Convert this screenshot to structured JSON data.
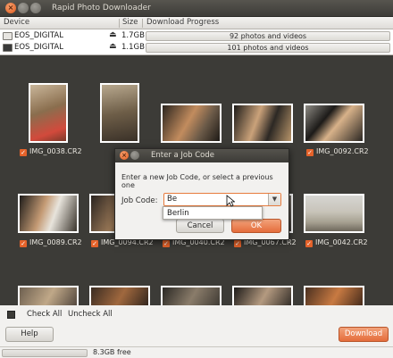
{
  "window": {
    "title": "Rapid Photo Downloader"
  },
  "device_table": {
    "headers": [
      "Device",
      "Size",
      "Download Progress"
    ],
    "rows": [
      {
        "name": "EOS_DIGITAL",
        "size": "1.7GB",
        "progress": "92 photos and videos"
      },
      {
        "name": "EOS_DIGITAL",
        "size": "1.1GB",
        "progress": "101 photos and videos"
      }
    ]
  },
  "thumbnails": {
    "row1": [
      "IMG_0038.CR2",
      "",
      "",
      "",
      "IMG_0092.CR2"
    ],
    "row2": [
      "IMG_0089.CR2",
      "IMG_0094.CR2",
      "IMG_0040.CR2",
      "IMG_0067.CR2",
      "IMG_0042.CR2"
    ]
  },
  "dialog": {
    "title": "Enter a Job Code",
    "message": "Enter a new Job Code, or select a previous one",
    "label": "Job Code:",
    "input_value": "Be",
    "suggestion": "Berlin",
    "cancel_label": "Cancel",
    "ok_label": "OK"
  },
  "bottom": {
    "check_all": "Check All",
    "uncheck_all": "Uncheck All",
    "help_label": "Help",
    "download_label": "Download",
    "free_space": "8.3GB free"
  },
  "colors": {
    "accent": "#e56d3c",
    "background": "#3c3b37"
  }
}
